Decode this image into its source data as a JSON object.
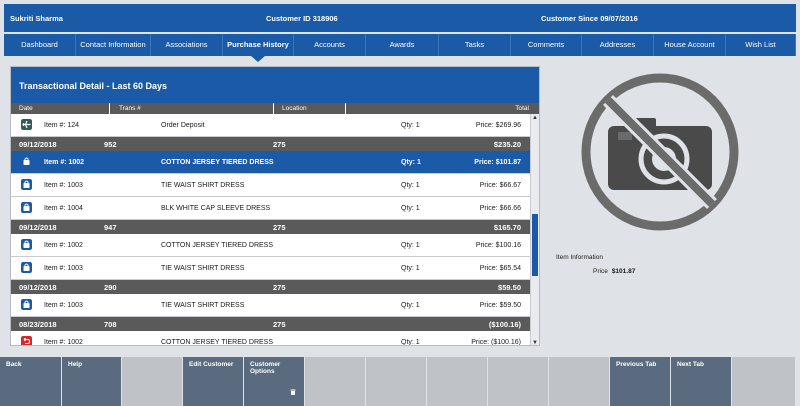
{
  "header": {
    "customer_name": "Sukriti Sharma",
    "customer_id_label": "Customer ID",
    "customer_id": "318906",
    "customer_since_label": "Customer Since",
    "customer_since": "09/07/2016"
  },
  "tabs": [
    {
      "label": "Dashboard",
      "active": false
    },
    {
      "label": "Contact Information",
      "active": false
    },
    {
      "label": "Associations",
      "active": false
    },
    {
      "label": "Purchase History",
      "active": true
    },
    {
      "label": "Accounts",
      "active": false
    },
    {
      "label": "Awards",
      "active": false
    },
    {
      "label": "Tasks",
      "active": false
    },
    {
      "label": "Comments",
      "active": false
    },
    {
      "label": "Addresses",
      "active": false
    },
    {
      "label": "House Account",
      "active": false
    },
    {
      "label": "Wish List",
      "active": false
    }
  ],
  "panel": {
    "title": "Transactional Detail - Last 60 Days",
    "columns": {
      "date": "Date",
      "trans": "Trans #",
      "location": "Location",
      "total": "Total"
    }
  },
  "rows": [
    {
      "kind": "item",
      "icon": "plane-icon",
      "item": "Item #: 124",
      "desc": "Order Deposit",
      "qty": "Qty: 1",
      "price": "Price: $269.96"
    },
    {
      "kind": "group",
      "date": "09/12/2018",
      "trans": "952",
      "location": "275",
      "total": "$235.20"
    },
    {
      "kind": "item",
      "icon": "shopping-bag-icon",
      "item": "Item #: 1002",
      "desc": "COTTON JERSEY TIERED DRESS",
      "qty": "Qty: 1",
      "price": "Price: $101.87",
      "selected": true
    },
    {
      "kind": "item",
      "icon": "shopping-bag-icon",
      "item": "Item #: 1003",
      "desc": "TIE WAIST SHIRT DRESS",
      "qty": "Qty: 1",
      "price": "Price: $66.67"
    },
    {
      "kind": "item",
      "icon": "shopping-bag-icon",
      "item": "Item #: 1004",
      "desc": "BLK WHITE CAP SLEEVE DRESS",
      "qty": "Qty: 1",
      "price": "Price: $66.66"
    },
    {
      "kind": "group",
      "date": "09/12/2018",
      "trans": "947",
      "location": "275",
      "total": "$165.70"
    },
    {
      "kind": "item",
      "icon": "shopping-bag-icon",
      "item": "Item #: 1002",
      "desc": "COTTON JERSEY TIERED DRESS",
      "qty": "Qty: 1",
      "price": "Price: $100.16"
    },
    {
      "kind": "item",
      "icon": "shopping-bag-icon",
      "item": "Item #: 1003",
      "desc": "TIE WAIST SHIRT DRESS",
      "qty": "Qty: 1",
      "price": "Price: $65.54"
    },
    {
      "kind": "group",
      "date": "09/12/2018",
      "trans": "290",
      "location": "275",
      "total": "$59.50"
    },
    {
      "kind": "item",
      "icon": "shopping-bag-icon",
      "item": "Item #: 1003",
      "desc": "TIE WAIST SHIRT DRESS",
      "qty": "Qty: 1",
      "price": "Price: $59.50"
    },
    {
      "kind": "group",
      "date": "08/23/2018",
      "trans": "708",
      "location": "275",
      "total": "($100.16)"
    },
    {
      "kind": "item",
      "icon": "return-icon",
      "item": "Item #: 1002",
      "desc": "COTTON JERSEY TIERED DRESS",
      "qty": "Qty: 1",
      "price": "Price:  ($100.16)"
    }
  ],
  "item_info": {
    "label": "Item Information",
    "price_label": "Price",
    "price": "$101.87",
    "image_icon": "no-camera-icon"
  },
  "footer_buttons": [
    {
      "label": "Back",
      "enabled": true
    },
    {
      "label": "Help",
      "enabled": true
    },
    {
      "label": "",
      "enabled": false
    },
    {
      "label": "Edit Customer",
      "enabled": true
    },
    {
      "label": "Customer Options",
      "enabled": true,
      "icon": "trash-icon"
    },
    {
      "label": "",
      "enabled": false
    },
    {
      "label": "",
      "enabled": false
    },
    {
      "label": "",
      "enabled": false
    },
    {
      "label": "",
      "enabled": false
    },
    {
      "label": "",
      "enabled": false
    },
    {
      "label": "Previous Tab",
      "enabled": true
    },
    {
      "label": "Next Tab",
      "enabled": true
    },
    {
      "label": "",
      "enabled": false
    }
  ],
  "colors": {
    "brand_blue": "#1a5aa6",
    "group_gray": "#5a5a5a",
    "footer_button": "#5a6b80",
    "return_red": "#d12a2a"
  }
}
